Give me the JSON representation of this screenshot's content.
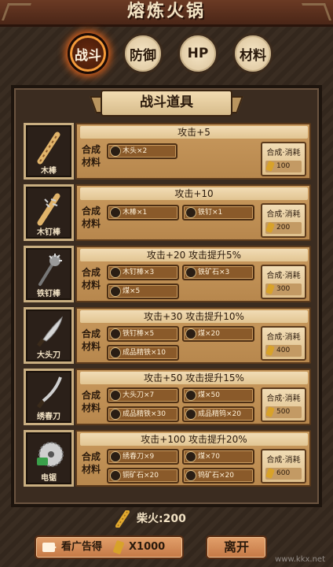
{
  "title": "熔炼火锅",
  "tabs": [
    {
      "label": "战斗",
      "active": true
    },
    {
      "label": "防御",
      "active": false
    },
    {
      "label": "HP",
      "active": false
    },
    {
      "label": "材料",
      "active": false
    }
  ],
  "section_title": "战斗道具",
  "synth_label": "合成\n材料",
  "cost_label": "合成·消耗",
  "items": [
    {
      "name": "木棒",
      "effect": "攻击+5",
      "materials": [
        "木头×2"
      ],
      "cost": "100"
    },
    {
      "name": "木钉棒",
      "effect": "攻击+10",
      "materials": [
        "木棒×1",
        "铁钉×1"
      ],
      "cost": "200"
    },
    {
      "name": "铁钉棒",
      "effect": "攻击+20 攻击提升5%",
      "materials": [
        "木钉棒×3",
        "铁矿石×3",
        "煤×5"
      ],
      "cost": "300"
    },
    {
      "name": "大头刀",
      "effect": "攻击+30 攻击提升10%",
      "materials": [
        "铁钉棒×5",
        "煤×20",
        "成品精铁×10"
      ],
      "cost": "400"
    },
    {
      "name": "绣春刀",
      "effect": "攻击+50 攻击提升15%",
      "materials": [
        "大头刀×7",
        "煤×50",
        "成品精铁×30",
        "成品精钨×20"
      ],
      "cost": "500"
    },
    {
      "name": "电锯",
      "effect": "攻击+100 攻击提升20%",
      "materials": [
        "绣春刀×9",
        "煤×70",
        "铜矿石×20",
        "钨矿石×20"
      ],
      "cost": "600"
    }
  ],
  "fuel": {
    "label": "柴火:200"
  },
  "ad_button": {
    "label": "看广告得",
    "amount": "X1000"
  },
  "leave_button": {
    "label": "离开"
  },
  "watermark": "www.kkx.net",
  "colors": {
    "accent_glow": "#e2651e",
    "panel": "#3b2c20",
    "card": "#c99a5e"
  }
}
